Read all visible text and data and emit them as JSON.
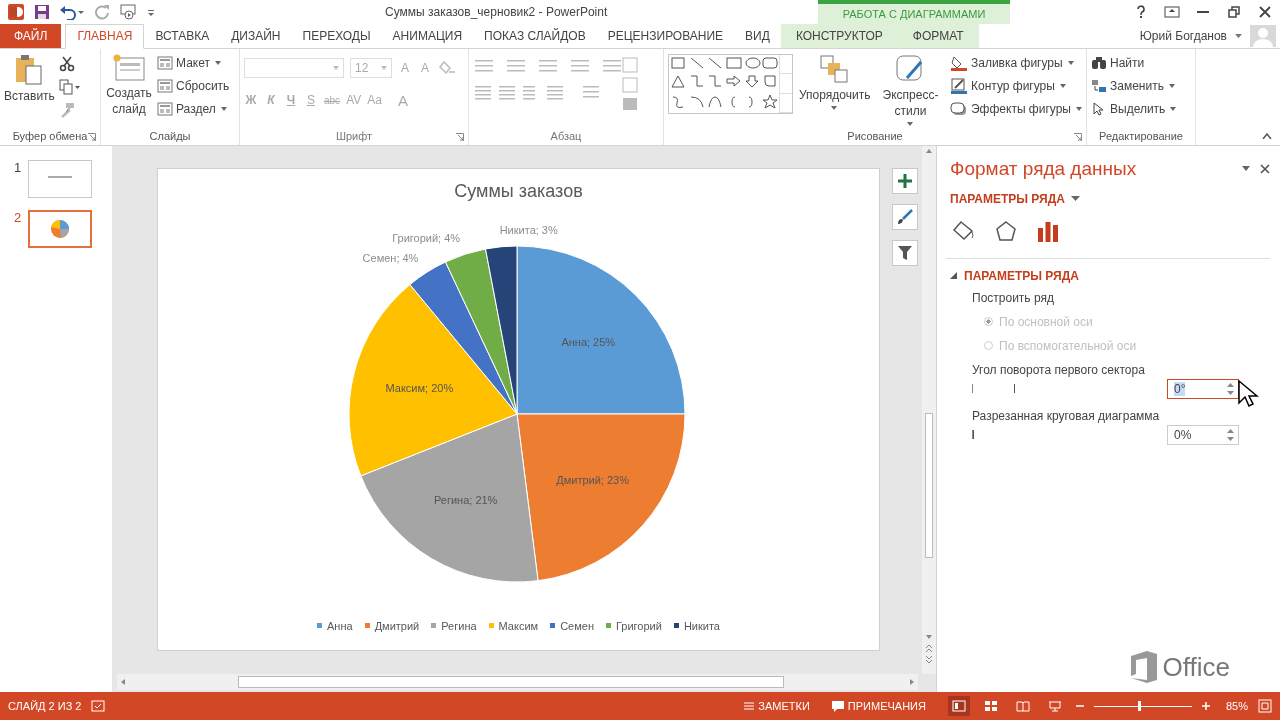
{
  "window": {
    "title": "Суммы заказов_черновик2 - PowerPoint",
    "contextual_header": "РАБОТА С ДИАГРАММАМИ"
  },
  "tabs": [
    {
      "label": "ФАЙЛ",
      "kind": "file",
      "selected": false
    },
    {
      "label": "ГЛАВНАЯ",
      "kind": "normal",
      "selected": true
    },
    {
      "label": "ВСТАВКА",
      "kind": "normal",
      "selected": false
    },
    {
      "label": "ДИЗАЙН",
      "kind": "normal",
      "selected": false
    },
    {
      "label": "ПЕРЕХОДЫ",
      "kind": "normal",
      "selected": false
    },
    {
      "label": "АНИМАЦИЯ",
      "kind": "normal",
      "selected": false
    },
    {
      "label": "ПОКАЗ СЛАЙДОВ",
      "kind": "normal",
      "selected": false
    },
    {
      "label": "РЕЦЕНЗИРОВАНИЕ",
      "kind": "normal",
      "selected": false
    },
    {
      "label": "ВИД",
      "kind": "normal",
      "selected": false
    },
    {
      "label": "КОНСТРУКТОР",
      "kind": "contextual",
      "selected": false
    },
    {
      "label": "ФОРМАТ",
      "kind": "contextual",
      "selected": false
    }
  ],
  "user": {
    "name": "Юрий Богданов"
  },
  "ribbon": {
    "groups": [
      {
        "kind": "clipboard",
        "label": "Буфер обмена",
        "disabled": false,
        "launcher": true,
        "paste": "Вставить"
      },
      {
        "kind": "slides",
        "label": "Слайды",
        "disabled": false,
        "launcher": false,
        "new_slide": "Создать слайд",
        "commands": [
          {
            "label": "Макет",
            "menu": true
          },
          {
            "label": "Сбросить",
            "menu": false
          },
          {
            "label": "Раздел",
            "menu": true
          }
        ]
      },
      {
        "kind": "font",
        "label": "Шрифт",
        "disabled": true,
        "launcher": true,
        "size": "12",
        "size_buttons": [
          "A",
          "A"
        ],
        "format_buttons": [
          "Ж",
          "К",
          "Ч",
          "S",
          "abc",
          "AV",
          "Aa",
          "A"
        ]
      },
      {
        "kind": "paragraph",
        "label": "Абзац",
        "disabled": true,
        "launcher": false
      },
      {
        "kind": "drawing",
        "label": "Рисование",
        "disabled": false,
        "launcher": true,
        "large": [
          {
            "label": "Упорядочить"
          },
          {
            "label": "Экспресс-стили"
          }
        ],
        "commands": [
          {
            "label": "Заливка фигуры",
            "menu": true
          },
          {
            "label": "Контур фигуры",
            "menu": true
          },
          {
            "label": "Эффекты фигуры",
            "menu": true
          }
        ]
      },
      {
        "kind": "editing",
        "label": "Редактирование",
        "disabled": false,
        "launcher": false,
        "commands": [
          {
            "label": "Найти",
            "menu": false
          },
          {
            "label": "Заменить",
            "menu": true
          },
          {
            "label": "Выделить",
            "menu": true
          }
        ]
      }
    ]
  },
  "slides": [
    {
      "number": "1",
      "selected": false,
      "kind": "title"
    },
    {
      "number": "2",
      "selected": true,
      "kind": "chart"
    }
  ],
  "chart": {
    "chart_data": {
      "type": "pie",
      "title": "Суммы заказов",
      "categories": [
        "Анна",
        "Дмитрий",
        "Регина",
        "Максим",
        "Семен",
        "Григорий",
        "Никита"
      ],
      "values": [
        25,
        23,
        21,
        20,
        4,
        4,
        3
      ],
      "value_labels": [
        "Анна; 25%",
        "Дмитрий; 23%",
        "Регина; 21%",
        "Максим; 20%",
        "Семен; 4%",
        "Григорий; 4%",
        "Никита; 3%"
      ],
      "legend": "bottom"
    }
  },
  "format_pane": {
    "title": "Формат ряда данных",
    "options_menu": "ПАРАМЕТРЫ РЯДА",
    "icon_tabs": [
      {
        "selected": false
      },
      {
        "selected": false
      },
      {
        "selected": true
      }
    ],
    "section": {
      "title": "ПАРАМЕТРЫ РЯДА",
      "expanded": true
    },
    "plot_on": {
      "label": "Построить ряд",
      "options": [
        {
          "label": "По основной оси",
          "selected": true,
          "disabled": true
        },
        {
          "label": "По вспомогательной оси",
          "selected": false,
          "disabled": true
        }
      ]
    },
    "sliders": [
      {
        "label": "Угол поворота первого сектора",
        "level": 0.22,
        "value": "0°",
        "focused": true
      },
      {
        "label": "Разрезанная круговая диаграмма",
        "level": 0,
        "value": "0%",
        "focused": false
      }
    ]
  },
  "brand": "Office",
  "status_bar": {
    "slide": "СЛАЙД 2 ИЗ 2",
    "notes": "ЗАМЕТКИ",
    "comments": "ПРИМЕЧАНИЯ",
    "views": [
      {
        "selected": true
      },
      {
        "selected": false
      },
      {
        "selected": false
      },
      {
        "selected": false
      }
    ],
    "zoom": {
      "level": 0.45,
      "reading": "85%"
    }
  }
}
